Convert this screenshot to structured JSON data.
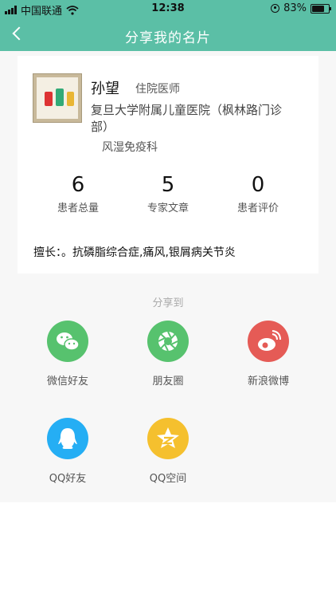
{
  "status_bar": {
    "carrier": "中国联通",
    "time": "12:38",
    "battery": "83%",
    "battery_level": 0.83
  },
  "nav": {
    "title": "分享我的名片"
  },
  "profile": {
    "name": "孙望",
    "title": "住院医师",
    "hospital": "复旦大学附属儿童医院（枫林路门诊部）",
    "department": "风湿免疫科"
  },
  "stats": [
    {
      "value": "6",
      "label": "患者总量"
    },
    {
      "value": "5",
      "label": "专家文章"
    },
    {
      "value": "0",
      "label": "患者评价"
    }
  ],
  "specialty": "擅长：。抗磷脂综合症,痛风,银屑病关节炎",
  "share": {
    "title": "分享到",
    "targets": [
      {
        "label": "微信好友",
        "icon": "wechat-icon",
        "color": "#57c26e"
      },
      {
        "label": "朋友圈",
        "icon": "moments-icon",
        "color": "#57c26e"
      },
      {
        "label": "新浪微博",
        "icon": "weibo-icon",
        "color": "#e55b56"
      },
      {
        "label": "QQ好友",
        "icon": "qq-icon",
        "color": "#25aef4"
      },
      {
        "label": "QQ空间",
        "icon": "qzone-icon",
        "color": "#f5c02e"
      }
    ]
  }
}
